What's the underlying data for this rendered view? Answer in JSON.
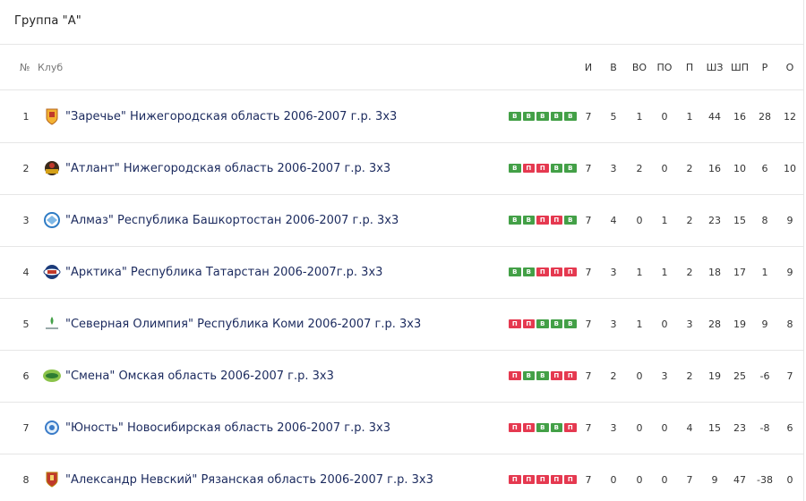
{
  "group_title": "Группа \"А\"",
  "columns": {
    "pos": "№",
    "club": "Клуб",
    "i": "И",
    "v": "В",
    "vo": "ВО",
    "po": "ПО",
    "p": "П",
    "shz": "ШЗ",
    "shp": "ШП",
    "r": "Р",
    "o": "О"
  },
  "colors": {
    "win": "#43a047",
    "loss": "#e53950",
    "club_text": "#1b2a5e"
  },
  "rows": [
    {
      "pos": "1",
      "club": "\"Заречье\" Нижегородская область 2006-2007 г.р. 3х3",
      "logo": "club-logo-zareche-icon",
      "form": [
        "В",
        "В",
        "В",
        "В",
        "В"
      ],
      "i": "7",
      "v": "5",
      "vo": "1",
      "po": "0",
      "p": "1",
      "shz": "44",
      "shp": "16",
      "r": "28",
      "o": "12"
    },
    {
      "pos": "2",
      "club": "\"Атлант\" Нижегородская область 2006-2007 г.р. 3х3",
      "logo": "club-logo-atlant-icon",
      "form": [
        "В",
        "П",
        "П",
        "В",
        "В"
      ],
      "i": "7",
      "v": "3",
      "vo": "2",
      "po": "0",
      "p": "2",
      "shz": "16",
      "shp": "10",
      "r": "6",
      "o": "10"
    },
    {
      "pos": "3",
      "club": "\"Алмаз\" Республика Башкортостан 2006-2007 г.р. 3х3",
      "logo": "club-logo-almaz-icon",
      "form": [
        "В",
        "В",
        "П",
        "П",
        "В"
      ],
      "i": "7",
      "v": "4",
      "vo": "0",
      "po": "1",
      "p": "2",
      "shz": "23",
      "shp": "15",
      "r": "8",
      "o": "9"
    },
    {
      "pos": "4",
      "club": "\"Арктика\" Республика Татарстан 2006-2007г.р. 3х3",
      "logo": "club-logo-arktika-icon",
      "form": [
        "В",
        "В",
        "П",
        "П",
        "П"
      ],
      "i": "7",
      "v": "3",
      "vo": "1",
      "po": "1",
      "p": "2",
      "shz": "18",
      "shp": "17",
      "r": "1",
      "o": "9"
    },
    {
      "pos": "5",
      "club": "\"Северная Олимпия\" Республика Коми 2006-2007 г.р. 3х3",
      "logo": "club-logo-severnaya-olimpiya-icon",
      "form": [
        "П",
        "П",
        "В",
        "В",
        "В"
      ],
      "i": "7",
      "v": "3",
      "vo": "1",
      "po": "0",
      "p": "3",
      "shz": "28",
      "shp": "19",
      "r": "9",
      "o": "8"
    },
    {
      "pos": "6",
      "club": "\"Смена\" Омская область 2006-2007 г.р. 3х3",
      "logo": "club-logo-smena-icon",
      "form": [
        "П",
        "В",
        "В",
        "П",
        "П"
      ],
      "i": "7",
      "v": "2",
      "vo": "0",
      "po": "3",
      "p": "2",
      "shz": "19",
      "shp": "25",
      "r": "-6",
      "o": "7"
    },
    {
      "pos": "7",
      "club": "\"Юность\" Новосибирская область 2006-2007 г.р. 3х3",
      "logo": "club-logo-yunost-icon",
      "form": [
        "П",
        "П",
        "В",
        "В",
        "П"
      ],
      "i": "7",
      "v": "3",
      "vo": "0",
      "po": "0",
      "p": "4",
      "shz": "15",
      "shp": "23",
      "r": "-8",
      "o": "6"
    },
    {
      "pos": "8",
      "club": "\"Александр Невский\" Рязанская область 2006-2007 г.р. 3х3",
      "logo": "club-logo-aleksandr-nevsky-icon",
      "form": [
        "П",
        "П",
        "П",
        "П",
        "П"
      ],
      "i": "7",
      "v": "0",
      "vo": "0",
      "po": "0",
      "p": "7",
      "shz": "9",
      "shp": "47",
      "r": "-38",
      "o": "0"
    }
  ]
}
